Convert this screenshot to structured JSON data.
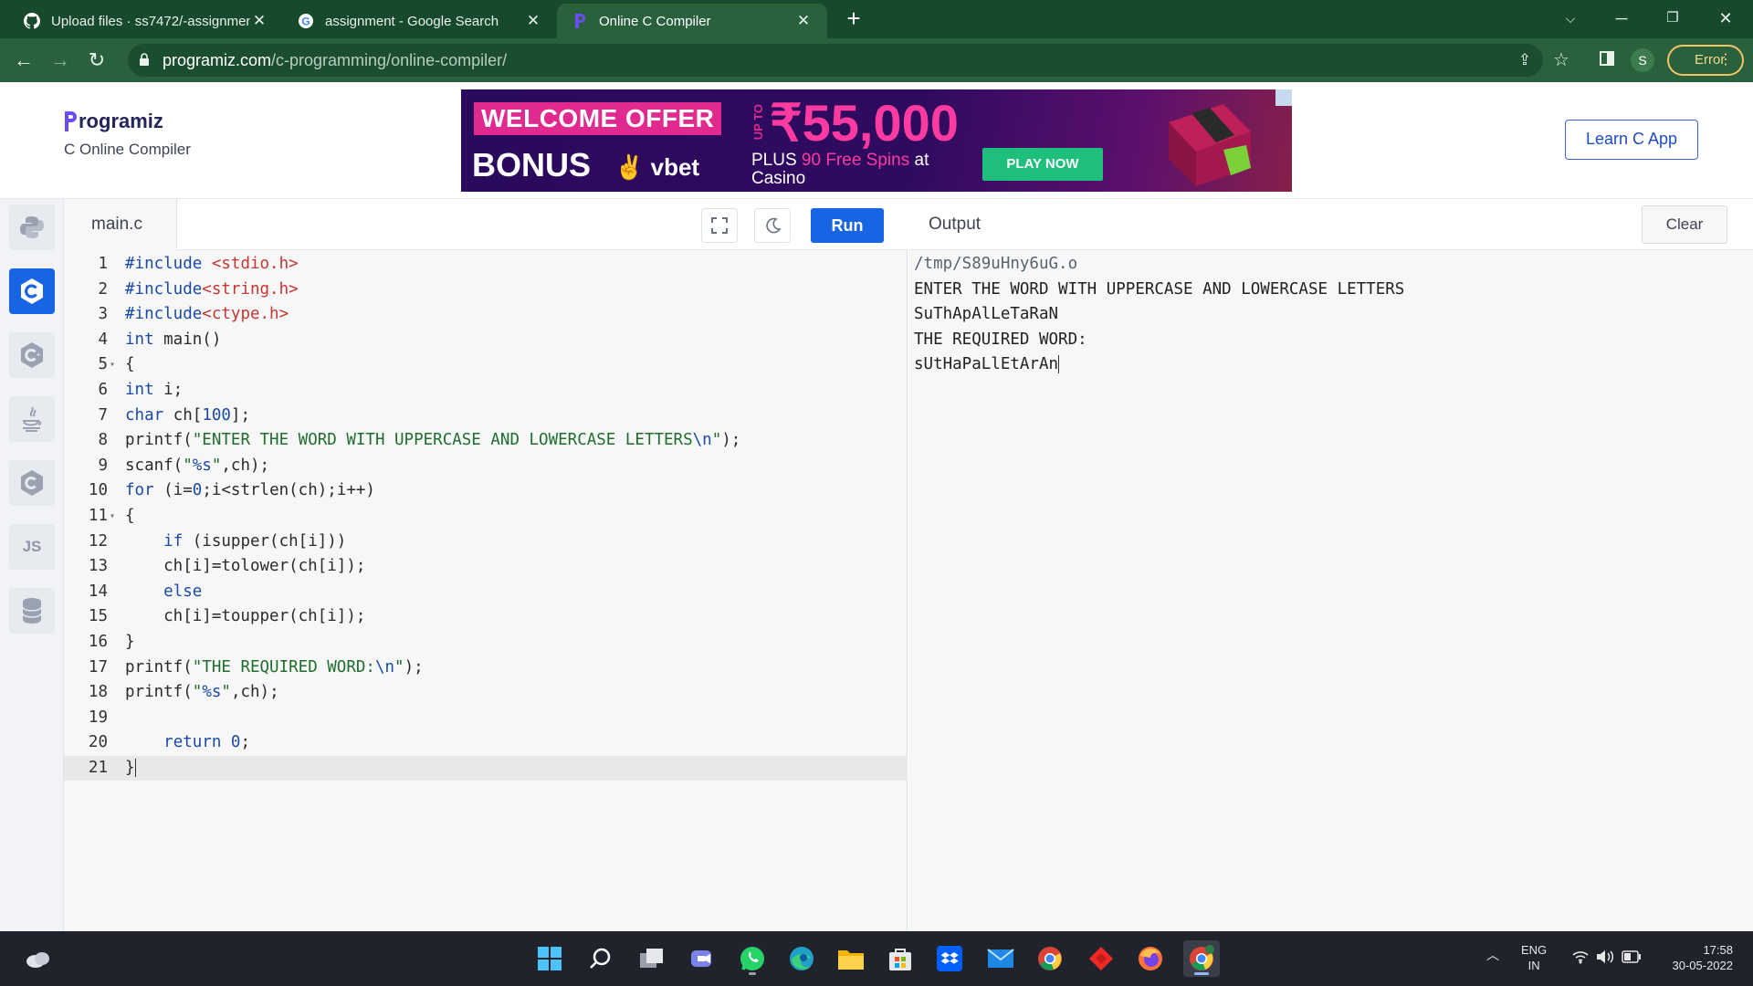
{
  "browser": {
    "tabs": [
      {
        "label": "Upload files · ss7472/-assignmen",
        "icon": "github-icon"
      },
      {
        "label": "assignment - Google Search",
        "icon": "google-icon"
      },
      {
        "label": "Online C Compiler",
        "icon": "programiz-icon",
        "active": true
      }
    ],
    "url_host": "programiz.com",
    "url_path": "/c-programming/online-compiler/",
    "profile_initial": "S",
    "error_label": "Error"
  },
  "header": {
    "brand": "rogramiz",
    "subtitle": "C Online Compiler",
    "learn_button": "Learn C App",
    "ad": {
      "welcome": "WELCOME OFFER",
      "upto": "UP TO",
      "amount": "₹55,000",
      "bonus": "BONUS",
      "vbet": "vbet",
      "plus_line1_a": "PLUS ",
      "plus_line1_b": "90 Free Spins",
      "plus_line1_c": " at",
      "plus_line2": "Casino",
      "cta": "PLAY NOW"
    }
  },
  "sidebar": {
    "languages": [
      {
        "name": "python",
        "icon": "python-icon"
      },
      {
        "name": "c",
        "icon": "c-icon",
        "active": true
      },
      {
        "name": "cpp",
        "icon": "cpp-icon"
      },
      {
        "name": "java",
        "icon": "java-icon"
      },
      {
        "name": "csharp",
        "icon": "csharp-icon"
      },
      {
        "name": "js",
        "icon": "js-icon",
        "label": "JS"
      },
      {
        "name": "sql",
        "icon": "database-icon"
      }
    ]
  },
  "editor": {
    "filename": "main.c",
    "run_label": "Run",
    "lines": [
      "#include <stdio.h>",
      "#include<string.h>",
      "#include<ctype.h>",
      "int main()",
      "{",
      "int i;",
      "char ch[100];",
      "printf(\"ENTER THE WORD WITH UPPERCASE AND LOWERCASE LETTERS\\n\");",
      "scanf(\"%s\",ch);",
      "for (i=0;i<strlen(ch);i++)",
      "{",
      "    if (isupper(ch[i]))",
      "    ch[i]=tolower(ch[i]);",
      "    else",
      "    ch[i]=toupper(ch[i]);",
      "}",
      "printf(\"THE REQUIRED WORD:\\n\");",
      "printf(\"%s\",ch);",
      "",
      "    return 0;",
      "}"
    ],
    "fold_lines": [
      5,
      11
    ],
    "current_line": 21
  },
  "output": {
    "title": "Output",
    "clear_label": "Clear",
    "lines": [
      "/tmp/S89uHny6uG.o",
      "ENTER THE WORD WITH UPPERCASE AND LOWERCASE LETTERS",
      "SuThApAlLeTaRaN",
      "THE REQUIRED WORD:",
      "sUtHaPaLlEtArAn"
    ]
  },
  "taskbar": {
    "lang_line1": "ENG",
    "lang_line2": "IN",
    "time": "17:58",
    "date": "30-05-2022"
  }
}
